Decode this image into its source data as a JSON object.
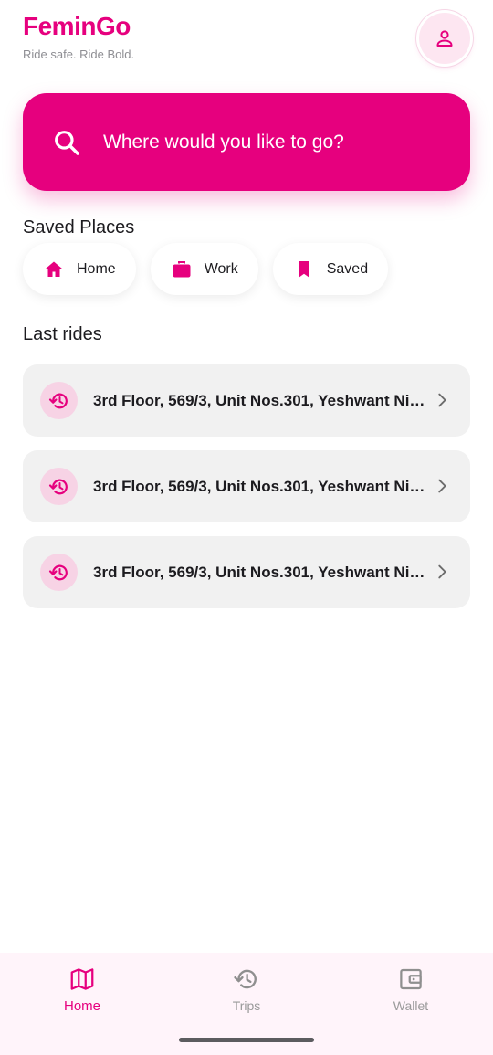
{
  "app": {
    "brand": "FeminGo",
    "tagline": "Ride safe. Ride Bold."
  },
  "search": {
    "placeholder": "Where would you like to go?"
  },
  "saved_places": {
    "title": "Saved Places",
    "items": [
      {
        "label": "Home",
        "icon": "home-icon"
      },
      {
        "label": "Work",
        "icon": "briefcase-icon"
      },
      {
        "label": "Saved",
        "icon": "bookmark-icon"
      }
    ]
  },
  "last_rides": {
    "title": "Last rides",
    "items": [
      {
        "address": "3rd Floor, 569/3, Unit Nos.301, Yeshwant Nilay"
      },
      {
        "address": "3rd Floor, 569/3, Unit Nos.301, Yeshwant Nilay"
      },
      {
        "address": "3rd Floor, 569/3, Unit Nos.301, Yeshwant Nilay"
      }
    ]
  },
  "nav": {
    "items": [
      {
        "label": "Home",
        "icon": "map-icon",
        "active": true
      },
      {
        "label": "Trips",
        "icon": "history-icon",
        "active": false
      },
      {
        "label": "Wallet",
        "icon": "wallet-icon",
        "active": false
      }
    ]
  },
  "colors": {
    "accent": "#e6007e",
    "accent_soft": "#fde6f1",
    "nav_background": "#fff4fa",
    "card_background": "#f1f1f1"
  }
}
